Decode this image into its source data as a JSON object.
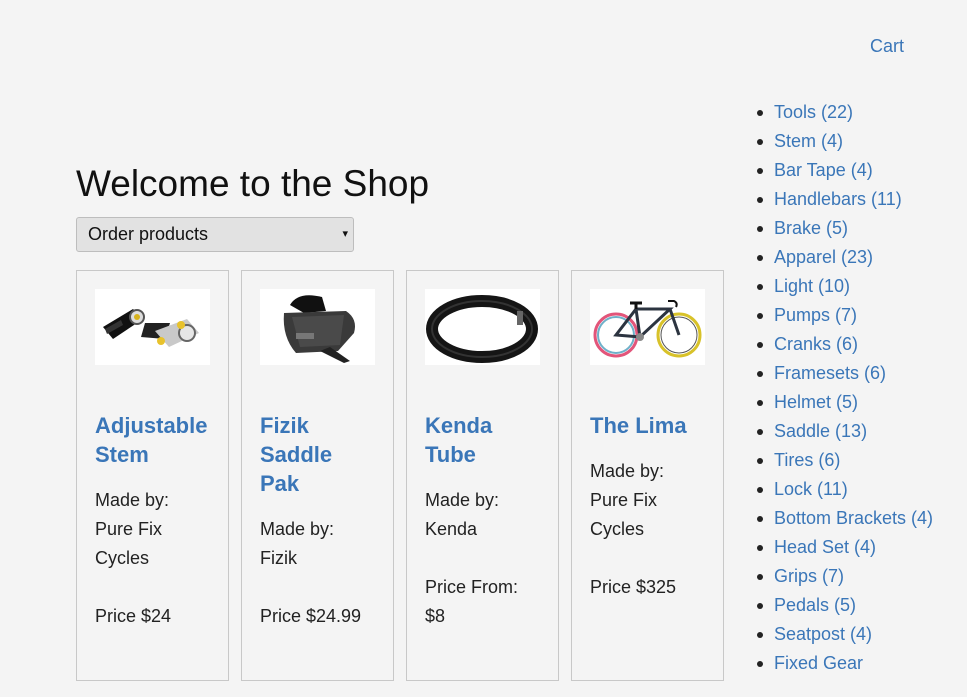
{
  "header": {
    "cart_label": "Cart"
  },
  "main": {
    "title": "Welcome to the Shop",
    "order_select": {
      "selected": "Order products",
      "arrow": "▾"
    },
    "products": [
      {
        "name": "Adjustable Stem",
        "maker_label": "Made by:",
        "maker": "Pure Fix Cycles",
        "price": "Price $24"
      },
      {
        "name": "Fizik Saddle Pak",
        "maker_label": "Made by:",
        "maker": "Fizik",
        "price": "Price $24.99"
      },
      {
        "name": "Kenda Tube",
        "maker_label": "Made by:",
        "maker": "Kenda",
        "price": "Price From: $8"
      },
      {
        "name": "The Lima",
        "maker_label": "Made by:",
        "maker": "Pure Fix Cycles",
        "price": "Price $325"
      }
    ]
  },
  "sidebar": {
    "categories": [
      "Tools (22)",
      "Stem (4)",
      "Bar Tape (4)",
      "Handlebars (11)",
      "Brake (5)",
      "Apparel (23)",
      "Light (10)",
      "Pumps (7)",
      "Cranks (6)",
      "Framesets (6)",
      "Helmet (5)",
      "Saddle (13)",
      "Tires (6)",
      "Lock (11)",
      "Bottom Brackets (4)",
      "Head Set (4)",
      "Grips (7)",
      "Pedals (5)",
      "Seatpost (4)",
      "Fixed Gear"
    ]
  },
  "colors": {
    "link": "#3a76b8",
    "background": "#f4f4f4"
  },
  "icons": {
    "product_images": [
      "stem-photo",
      "saddle-bag-photo",
      "inner-tube-photo",
      "fixed-gear-bike-photo"
    ]
  }
}
